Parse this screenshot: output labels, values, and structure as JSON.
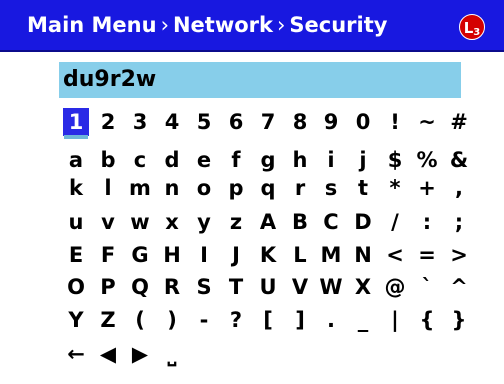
{
  "header": {
    "breadcrumb": [
      "Main Menu",
      "Network",
      "Security"
    ],
    "separator": "›",
    "logo": {
      "text": "L",
      "sub": "3",
      "color": "#d40000"
    }
  },
  "input": {
    "value": "du9r2w"
  },
  "keyboard": {
    "selected_key": "1",
    "rows": [
      [
        "1",
        "2",
        "3",
        "4",
        "5",
        "6",
        "7",
        "8",
        "9",
        "0",
        "!",
        "~",
        "#"
      ],
      [
        "a",
        "b",
        "c",
        "d",
        "e",
        "f",
        "g",
        "h",
        "i",
        "j",
        "$",
        "%",
        "&"
      ],
      [
        "k",
        "l",
        "m",
        "n",
        "o",
        "p",
        "q",
        "r",
        "s",
        "t",
        "*",
        "+",
        ","
      ],
      [
        "u",
        "v",
        "w",
        "x",
        "y",
        "z",
        "A",
        "B",
        "C",
        "D",
        "/",
        ":",
        ";"
      ],
      [
        "E",
        "F",
        "G",
        "H",
        "I",
        "J",
        "K",
        "L",
        "M",
        "N",
        "<",
        "=",
        ">"
      ],
      [
        "O",
        "P",
        "Q",
        "R",
        "S",
        "T",
        "U",
        "V",
        "W",
        "X",
        "@",
        "`",
        "^"
      ],
      [
        "Y",
        "Z",
        "(",
        ")",
        "-",
        "?",
        "[",
        "]",
        ".",
        "_",
        "|",
        "{",
        "}"
      ]
    ],
    "controls": [
      {
        "name": "backspace-key",
        "glyph": "←"
      },
      {
        "name": "cursor-left-key",
        "glyph": "◀"
      },
      {
        "name": "cursor-right-key",
        "glyph": "▶"
      },
      {
        "name": "space-key",
        "glyph": "⎵"
      }
    ]
  },
  "colors": {
    "title_bar": "#1818e0",
    "input_bg": "#87ceea",
    "selection": "#2a2ae6"
  }
}
